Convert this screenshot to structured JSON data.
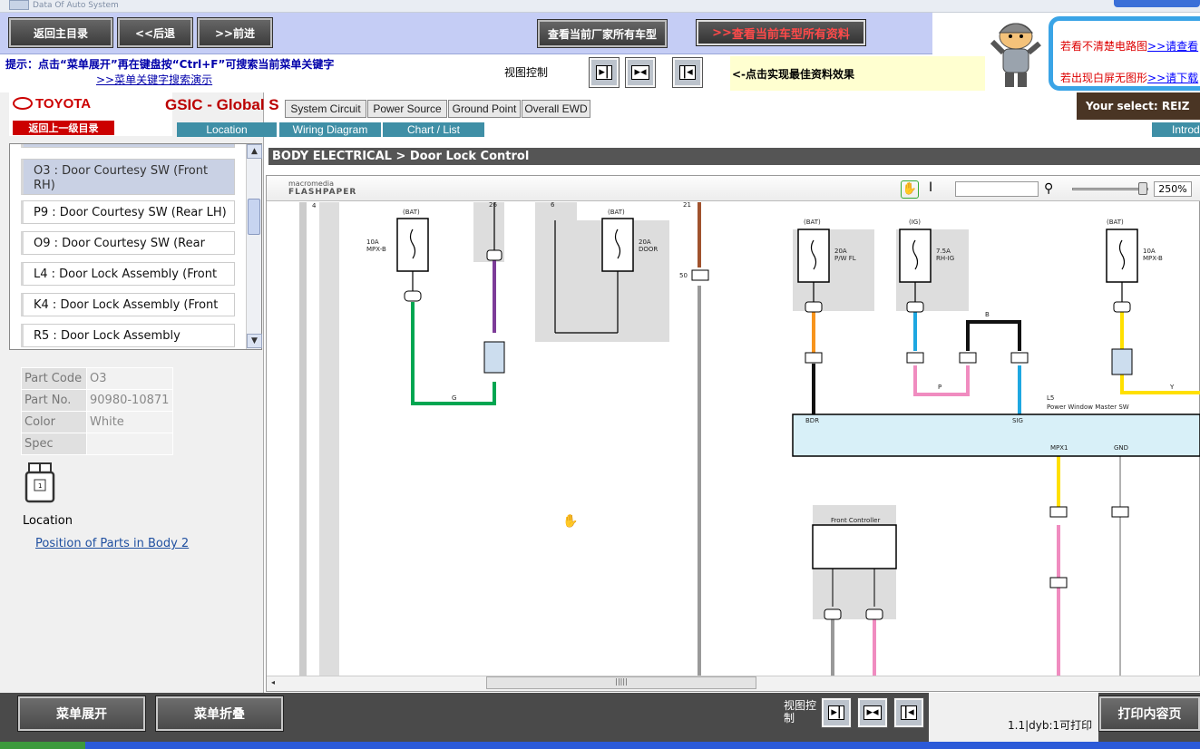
{
  "topstrip": {
    "brand": "Data Of Auto System"
  },
  "header": {
    "main_menu": "返回主目录",
    "back": "<<后退",
    "forward": ">>前进",
    "all_models": "查看当前厂家所有车型",
    "all_docs": "查看当前车型所有资料",
    "all_docs_prefix": ">>"
  },
  "hint": {
    "text": "提示：点击“菜单展开”再在键盘按“Ctrl+F”可搜索当前菜单关键字",
    "link": ">>菜单关键字搜索演示",
    "view_control": "视图控制",
    "best_view": "<-点击实现最佳资料效果"
  },
  "ad": {
    "line1": "若看不清楚电路图",
    "line1_link": ">>请查看",
    "line2": "若出现白屏无图形",
    "line2_link": ">>请下载"
  },
  "brandbar": {
    "logo": "TOYOTA",
    "back_level": "返回上一级目录",
    "gsic": "GSIC - Global S",
    "your_select": "Your select: REIZ"
  },
  "tabs_grey": [
    "System Circuit",
    "Power Source",
    "Ground Point",
    "Overall EWD"
  ],
  "tabs_teal": [
    "Location",
    "Wiring Diagram",
    "Chart / List",
    "Introd"
  ],
  "list": {
    "items": [
      "O3 : Door Courtesy SW (Front RH)",
      "P9 : Door Courtesy SW (Rear LH)",
      "O9 : Door Courtesy SW (Rear",
      "L4 : Door Lock Assembly (Front",
      "K4 : Door Lock Assembly (Front",
      "R5 : Door Lock Assembly"
    ]
  },
  "part": {
    "rows": [
      {
        "k": "Part Code",
        "v": "O3"
      },
      {
        "k": "Part No.",
        "v": "90980-10871"
      },
      {
        "k": "Color",
        "v": "White"
      },
      {
        "k": "Spec",
        "v": ""
      }
    ],
    "location_label": "Location",
    "location_link": "Position of Parts in Body 2"
  },
  "breadcrumb": "BODY ELECTRICAL > Door Lock Control",
  "viewer": {
    "logo_top": "macromedia",
    "logo_bottom": "FLASHPAPER",
    "zoom": "250%"
  },
  "bottom": {
    "expand": "菜单展开",
    "collapse": "菜单折叠",
    "view_control": "视图控制",
    "page_info": "1.1|dyb:1可打印",
    "print": "打印内容页"
  },
  "colors": {
    "header_bg": "#c5cdf5",
    "teal_tab": "#3f8fa6",
    "wire_green": "#00a651",
    "wire_purple": "#7d3c98",
    "wire_orange": "#f7941d",
    "wire_blue": "#1ea7e1",
    "wire_pink": "#f08cc0",
    "wire_yellow": "#ffe000"
  }
}
